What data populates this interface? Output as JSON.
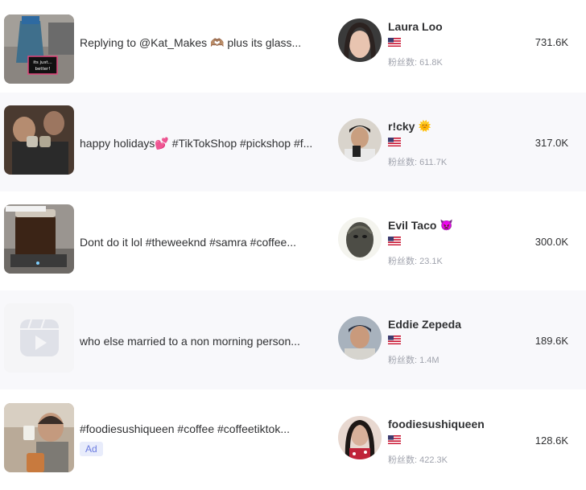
{
  "rows": [
    {
      "caption": "Replying to @Kat_Makes 🫶🏽 plus its glass...",
      "creator_name": "Laura Loo",
      "creator_emoji": "",
      "followers": "粉丝数: 61.8K",
      "views": "731.6K",
      "ad": "",
      "thumb_text": "its just... better!"
    },
    {
      "caption": "happy holidays💕 #TikTokShop #pickshop #f...",
      "creator_name": "r!cky",
      "creator_emoji": "🌞",
      "followers": "粉丝数: 611.7K",
      "views": "317.0K",
      "ad": "",
      "thumb_text": ""
    },
    {
      "caption": "Dont do it lol #theweeknd #samra #coffee...",
      "creator_name": "Evil Taco",
      "creator_emoji": "👿",
      "followers": "粉丝数: 23.1K",
      "views": "300.0K",
      "ad": "",
      "thumb_text": ""
    },
    {
      "caption": "who else married to a non morning person...",
      "creator_name": "Eddie Zepeda",
      "creator_emoji": "",
      "followers": "粉丝数: 1.4M",
      "views": "189.6K",
      "ad": "",
      "thumb_text": ""
    },
    {
      "caption": "#foodiesushiqueen #coffee #coffeetiktok...",
      "creator_name": "foodiesushiqueen",
      "creator_emoji": "",
      "followers": "粉丝数: 422.3K",
      "views": "128.6K",
      "ad": "Ad",
      "thumb_text": ""
    }
  ],
  "colors": {
    "alt_row": "#f8f8fb",
    "ad_bg": "#e8ecfb",
    "ad_text": "#6b7be0",
    "muted": "#a0a3ad"
  }
}
